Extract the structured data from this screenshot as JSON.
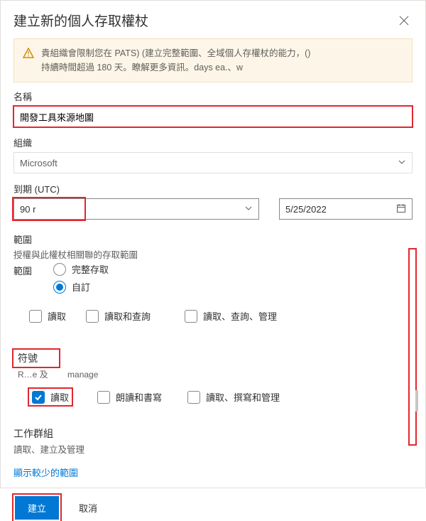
{
  "dialog": {
    "title": "建立新的個人存取權杖"
  },
  "banner": {
    "line1": "貴組織會限制您在 PATS) (建立完整範圍、全域個人存權杖的能力，()",
    "line2": "持續時間超過 180 天。瞭解更多資訊。days ea.、w"
  },
  "labels": {
    "name": "名稱",
    "org": "組織",
    "expires": "到期 (UTC)",
    "scope_header": "範圍",
    "scope_desc": "授權與此權杖相關聯的存取範圍",
    "scope_label": "範圍"
  },
  "fields": {
    "name_value": "開發工具來源地圖",
    "org_value": "Microsoft",
    "expires_value": "90 r",
    "expires_date": "5/25/2022"
  },
  "scope_radio": {
    "full": "完整存取",
    "custom": "自訂"
  },
  "scope_row1": {
    "opt1": "讀取",
    "opt2": "讀取和查詢",
    "opt3": "讀取、查詢、管理"
  },
  "symbols": {
    "title": "符號",
    "sub_left": "R…e 及",
    "sub_right": "manage",
    "opt1": "讀取",
    "opt2": "朗讀和書寫",
    "opt3": "讀取、撰寫和管理"
  },
  "task_group": {
    "title": "工作群組",
    "sub": "讀取、建立及管理"
  },
  "links": {
    "show_fewer": "顯示較少的範圍"
  },
  "buttons": {
    "create": "建立",
    "cancel": "取消"
  }
}
